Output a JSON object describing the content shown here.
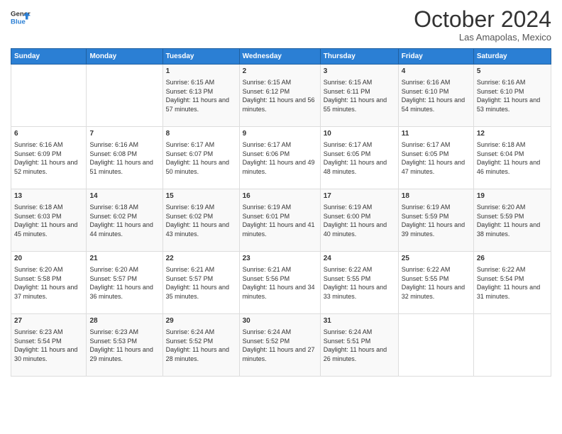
{
  "header": {
    "logo_line1": "General",
    "logo_line2": "Blue",
    "month": "October 2024",
    "location": "Las Amapolas, Mexico"
  },
  "columns": [
    "Sunday",
    "Monday",
    "Tuesday",
    "Wednesday",
    "Thursday",
    "Friday",
    "Saturday"
  ],
  "weeks": [
    [
      {
        "day": "",
        "text": ""
      },
      {
        "day": "",
        "text": ""
      },
      {
        "day": "1",
        "text": "Sunrise: 6:15 AM\nSunset: 6:13 PM\nDaylight: 11 hours and 57 minutes."
      },
      {
        "day": "2",
        "text": "Sunrise: 6:15 AM\nSunset: 6:12 PM\nDaylight: 11 hours and 56 minutes."
      },
      {
        "day": "3",
        "text": "Sunrise: 6:15 AM\nSunset: 6:11 PM\nDaylight: 11 hours and 55 minutes."
      },
      {
        "day": "4",
        "text": "Sunrise: 6:16 AM\nSunset: 6:10 PM\nDaylight: 11 hours and 54 minutes."
      },
      {
        "day": "5",
        "text": "Sunrise: 6:16 AM\nSunset: 6:10 PM\nDaylight: 11 hours and 53 minutes."
      }
    ],
    [
      {
        "day": "6",
        "text": "Sunrise: 6:16 AM\nSunset: 6:09 PM\nDaylight: 11 hours and 52 minutes."
      },
      {
        "day": "7",
        "text": "Sunrise: 6:16 AM\nSunset: 6:08 PM\nDaylight: 11 hours and 51 minutes."
      },
      {
        "day": "8",
        "text": "Sunrise: 6:17 AM\nSunset: 6:07 PM\nDaylight: 11 hours and 50 minutes."
      },
      {
        "day": "9",
        "text": "Sunrise: 6:17 AM\nSunset: 6:06 PM\nDaylight: 11 hours and 49 minutes."
      },
      {
        "day": "10",
        "text": "Sunrise: 6:17 AM\nSunset: 6:05 PM\nDaylight: 11 hours and 48 minutes."
      },
      {
        "day": "11",
        "text": "Sunrise: 6:17 AM\nSunset: 6:05 PM\nDaylight: 11 hours and 47 minutes."
      },
      {
        "day": "12",
        "text": "Sunrise: 6:18 AM\nSunset: 6:04 PM\nDaylight: 11 hours and 46 minutes."
      }
    ],
    [
      {
        "day": "13",
        "text": "Sunrise: 6:18 AM\nSunset: 6:03 PM\nDaylight: 11 hours and 45 minutes."
      },
      {
        "day": "14",
        "text": "Sunrise: 6:18 AM\nSunset: 6:02 PM\nDaylight: 11 hours and 44 minutes."
      },
      {
        "day": "15",
        "text": "Sunrise: 6:19 AM\nSunset: 6:02 PM\nDaylight: 11 hours and 43 minutes."
      },
      {
        "day": "16",
        "text": "Sunrise: 6:19 AM\nSunset: 6:01 PM\nDaylight: 11 hours and 41 minutes."
      },
      {
        "day": "17",
        "text": "Sunrise: 6:19 AM\nSunset: 6:00 PM\nDaylight: 11 hours and 40 minutes."
      },
      {
        "day": "18",
        "text": "Sunrise: 6:19 AM\nSunset: 5:59 PM\nDaylight: 11 hours and 39 minutes."
      },
      {
        "day": "19",
        "text": "Sunrise: 6:20 AM\nSunset: 5:59 PM\nDaylight: 11 hours and 38 minutes."
      }
    ],
    [
      {
        "day": "20",
        "text": "Sunrise: 6:20 AM\nSunset: 5:58 PM\nDaylight: 11 hours and 37 minutes."
      },
      {
        "day": "21",
        "text": "Sunrise: 6:20 AM\nSunset: 5:57 PM\nDaylight: 11 hours and 36 minutes."
      },
      {
        "day": "22",
        "text": "Sunrise: 6:21 AM\nSunset: 5:57 PM\nDaylight: 11 hours and 35 minutes."
      },
      {
        "day": "23",
        "text": "Sunrise: 6:21 AM\nSunset: 5:56 PM\nDaylight: 11 hours and 34 minutes."
      },
      {
        "day": "24",
        "text": "Sunrise: 6:22 AM\nSunset: 5:55 PM\nDaylight: 11 hours and 33 minutes."
      },
      {
        "day": "25",
        "text": "Sunrise: 6:22 AM\nSunset: 5:55 PM\nDaylight: 11 hours and 32 minutes."
      },
      {
        "day": "26",
        "text": "Sunrise: 6:22 AM\nSunset: 5:54 PM\nDaylight: 11 hours and 31 minutes."
      }
    ],
    [
      {
        "day": "27",
        "text": "Sunrise: 6:23 AM\nSunset: 5:54 PM\nDaylight: 11 hours and 30 minutes."
      },
      {
        "day": "28",
        "text": "Sunrise: 6:23 AM\nSunset: 5:53 PM\nDaylight: 11 hours and 29 minutes."
      },
      {
        "day": "29",
        "text": "Sunrise: 6:24 AM\nSunset: 5:52 PM\nDaylight: 11 hours and 28 minutes."
      },
      {
        "day": "30",
        "text": "Sunrise: 6:24 AM\nSunset: 5:52 PM\nDaylight: 11 hours and 27 minutes."
      },
      {
        "day": "31",
        "text": "Sunrise: 6:24 AM\nSunset: 5:51 PM\nDaylight: 11 hours and 26 minutes."
      },
      {
        "day": "",
        "text": ""
      },
      {
        "day": "",
        "text": ""
      }
    ]
  ]
}
